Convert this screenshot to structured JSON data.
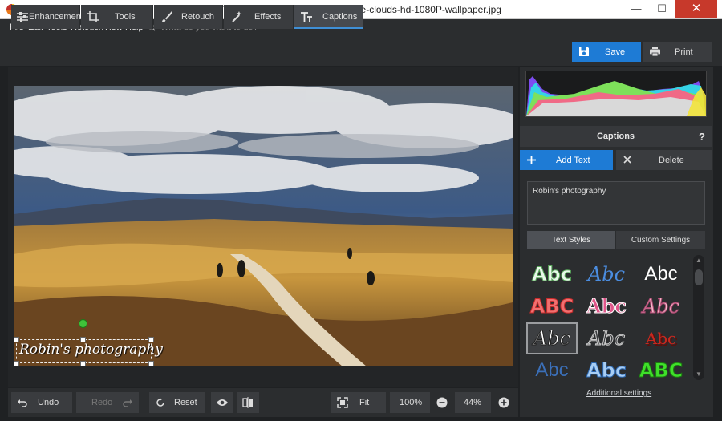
{
  "window": {
    "title": "PhotoWorks - path-trail-landscape-clouds-hd-1080P-wallpaper.jpg"
  },
  "menu": {
    "items": [
      "File",
      "Edit",
      "Tools",
      "Retouch",
      "View",
      "Help"
    ],
    "search_placeholder": "What do you want to do?"
  },
  "tabs": [
    {
      "label": "Enhancement",
      "icon": "sliders-icon"
    },
    {
      "label": "Tools",
      "icon": "crop-icon"
    },
    {
      "label": "Retouch",
      "icon": "brush-icon"
    },
    {
      "label": "Effects",
      "icon": "magic-wand-icon"
    },
    {
      "label": "Captions",
      "icon": "text-icon",
      "active": true
    }
  ],
  "actions": {
    "save": "Save",
    "print": "Print"
  },
  "canvas": {
    "caption_text": "Robin's photography"
  },
  "bottom": {
    "undo": "Undo",
    "redo": "Redo",
    "reset": "Reset",
    "fit": "Fit",
    "zoom_100": "100%",
    "zoom_value": "44%"
  },
  "panel": {
    "title": "Captions",
    "help": "?",
    "add_text": "Add Text",
    "delete": "Delete",
    "text_value": "Robin's photography",
    "style_tabs": [
      "Text Styles",
      "Custom Settings"
    ],
    "style_sample": "Abc",
    "style_sample_caps": "ABC",
    "additional_settings": "Additional settings"
  },
  "colors": {
    "accent": "#1e7bd5",
    "bg": "#1f2123",
    "panel": "#2b2d2f",
    "handle": "#3fc23a"
  }
}
